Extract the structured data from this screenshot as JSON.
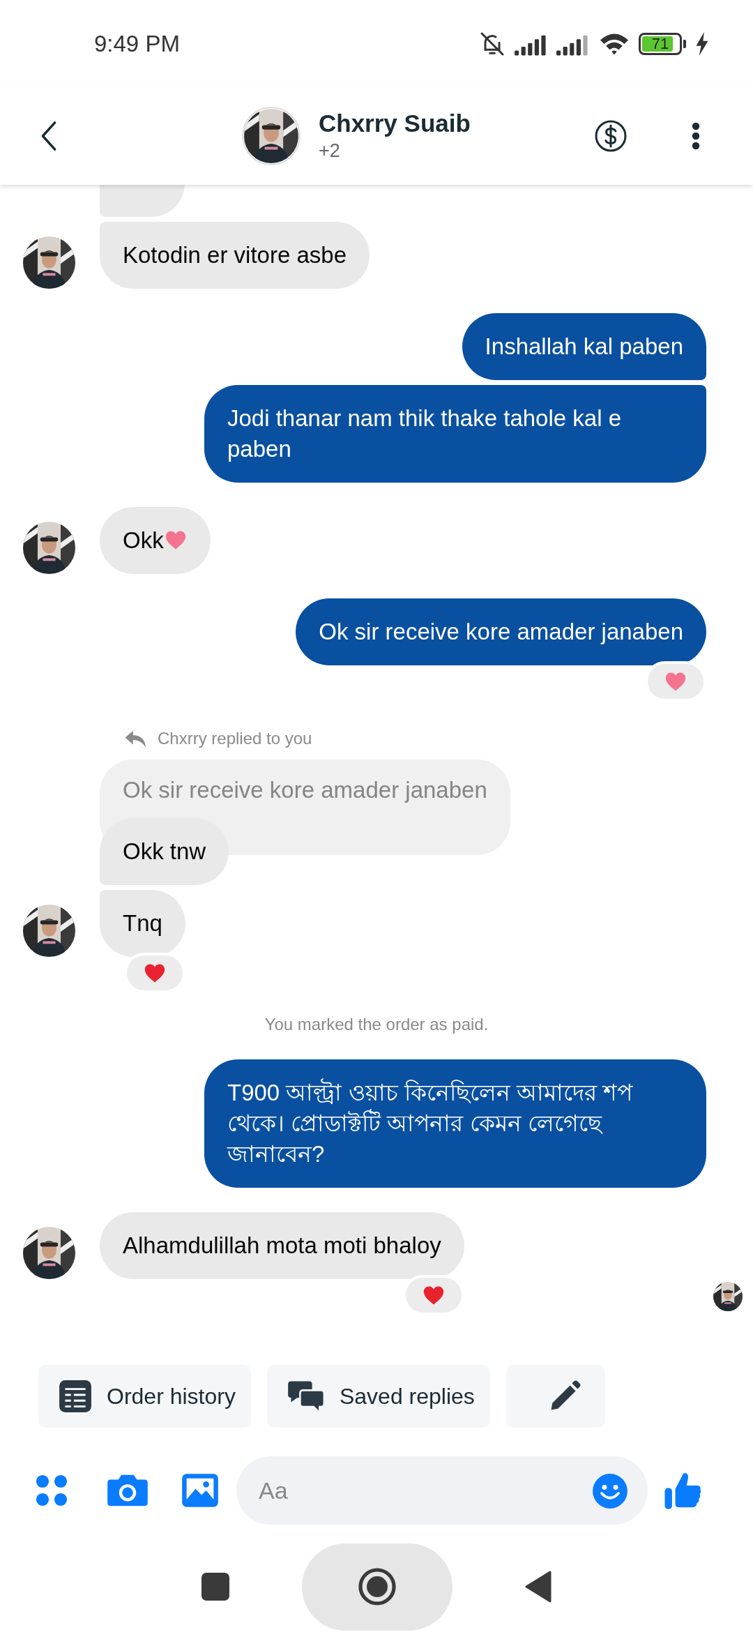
{
  "status_bar": {
    "time": "9:49 PM",
    "battery": "71"
  },
  "header": {
    "name": "Chxrry Suaib",
    "subtitle": "+2"
  },
  "messages": [
    {
      "kind": "received",
      "avatar": false
    },
    {
      "kind": "received",
      "text": "Kotodin er vitore asbe",
      "avatar": true
    },
    {
      "kind": "sent",
      "text": "Inshallah kal paben"
    },
    {
      "kind": "sent",
      "text": "Jodi thanar nam thik thake tahole kal e paben"
    },
    {
      "kind": "received",
      "text": "Okk",
      "avatar": true,
      "trailing_heart": {
        "color": "#f4738f"
      }
    },
    {
      "kind": "sent",
      "text": "Ok sir receive kore amader janaben",
      "reaction": {
        "color": "#f4738f"
      }
    },
    {
      "kind": "reply_label",
      "text": "Chxrry replied to you"
    },
    {
      "kind": "quoted",
      "text": "Ok sir receive kore amader janaben"
    },
    {
      "kind": "received",
      "text": "Okk tnw",
      "avatar": false
    },
    {
      "kind": "received",
      "text": "Tnq",
      "avatar": true,
      "reaction": {
        "color": "#e8222f"
      }
    },
    {
      "kind": "system",
      "text": "You marked the order as paid."
    },
    {
      "kind": "sent",
      "text": "T900 আল্ট্রা ওয়াচ কিনেছিলেন আমাদের শপ থেকে। প্রোডাক্টটি আপনার কেমন লেগেছে জানাবেন?"
    },
    {
      "kind": "received",
      "text": "Alhamdulillah mota moti bhaloy",
      "avatar": true,
      "reaction": {
        "color": "#e8222f"
      }
    }
  ],
  "read_receipt": true,
  "quick_actions": [
    {
      "kind": "order",
      "label": "Order history"
    },
    {
      "kind": "saved",
      "label": "Saved replies"
    },
    {
      "kind": "edit"
    }
  ],
  "composer": {
    "placeholder": "Aa"
  }
}
